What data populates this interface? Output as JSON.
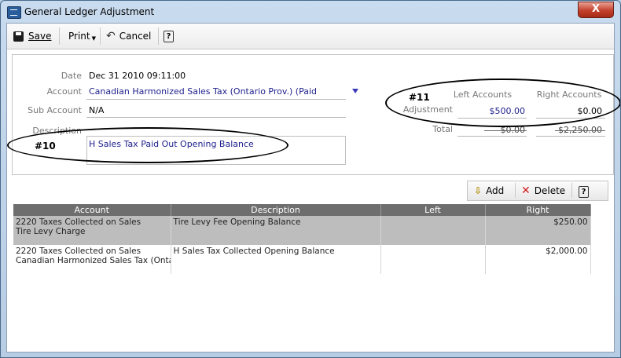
{
  "window": {
    "title": "General Ledger Adjustment",
    "close_label": "X"
  },
  "toolbar": {
    "save_label": "Save",
    "print_label": "Print",
    "cancel_label": "Cancel",
    "help_label": "?"
  },
  "form": {
    "date_label": "Date",
    "date_value": "Dec 31 2010 09:11:00",
    "account_label": "Account",
    "account_value": "Canadian Harmonized Sales Tax (Ontario Prov.) (Paid",
    "subaccount_label": "Sub Account",
    "subaccount_value": "N/A",
    "description_label": "Description",
    "description_value": "H Sales Tax Paid Out Opening Balance",
    "left_accounts_label": "Left Accounts",
    "right_accounts_label": "Right Accounts",
    "adjustment_label": "Adjustment",
    "adjustment_left": "$500.00",
    "adjustment_right": "$0.00",
    "total_label": "Total",
    "total_left": "$0.00",
    "total_right": "$2,250.00"
  },
  "annotations": {
    "a10": "#10",
    "a11": "#11"
  },
  "grid_toolbar": {
    "add_label": "Add",
    "delete_label": "Delete",
    "help_label": "?"
  },
  "grid": {
    "columns": [
      "Account",
      "Description",
      "Left",
      "Right"
    ],
    "rows": [
      {
        "account_line1": "2220 Taxes Collected on Sales",
        "account_line2": "Tire Levy Charge",
        "description": "Tire Levy Fee Opening Balance",
        "left": "",
        "right": "$250.00"
      },
      {
        "account_line1": "2220 Taxes Collected on Sales",
        "account_line2": "Canadian Harmonized Sales Tax (Ontario",
        "description": "H Sales Tax Collected Opening Balance",
        "left": "",
        "right": "$2,000.00"
      }
    ]
  },
  "colors": {
    "header_bg": "#6e6e6e",
    "selected_row": "#bdbdbd",
    "value_blue": "#1d1f8c",
    "close_red": "#c3402b"
  }
}
